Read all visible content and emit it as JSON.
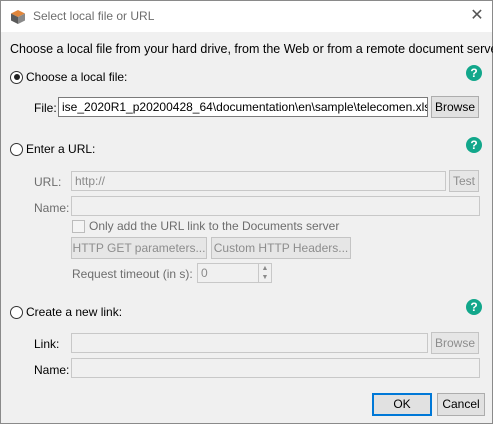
{
  "window": {
    "title": "Select local file or URL",
    "close_label": "✕"
  },
  "description": "Choose a local file from your hard drive, from the Web or from a remote document server.",
  "local": {
    "radio_label": "Choose a local file:",
    "file_label": "File:",
    "file_value": "ise_2020R1_p20200428_64\\documentation\\en\\sample\\telecomen.xls",
    "browse_label": "Browse",
    "checked": true
  },
  "url": {
    "radio_label": "Enter a URL:",
    "url_label": "URL:",
    "url_value": "http://",
    "test_label": "Test",
    "name_label": "Name:",
    "name_value": "",
    "only_add_label": "Only add the URL link to the Documents server",
    "http_get_label": "HTTP GET parameters...",
    "custom_headers_label": "Custom HTTP Headers...",
    "timeout_label": "Request timeout (in s):",
    "timeout_value": "0"
  },
  "newlink": {
    "radio_label": "Create a new link:",
    "link_label": "Link:",
    "link_value": "",
    "browse_label": "Browse",
    "name_label": "Name:",
    "name_value": ""
  },
  "help_label": "?",
  "footer": {
    "ok_label": "OK",
    "cancel_label": "Cancel"
  },
  "colors": {
    "help_accent": "#12a78b",
    "default_button_border": "#0078d7"
  }
}
